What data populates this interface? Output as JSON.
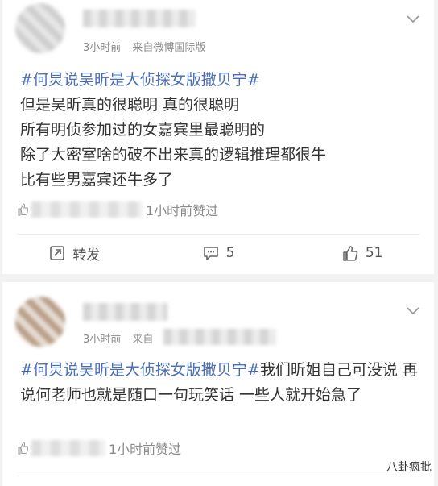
{
  "post1": {
    "meta_time": "3小时前",
    "meta_source": "来自微博国际版",
    "hashtag": "#何炅说吴昕是大侦探女版撒贝宁#",
    "lines": [
      "但是吴昕真的很聪明 真的很聪明",
      "所有明侦参加过的女嘉宾里最聪明的",
      "除了大密室啥的破不出来真的逻辑推理都很牛",
      "比有些男嘉宾还牛多了"
    ],
    "liked_text": "1小时前赞过",
    "repost_label": "转发",
    "comment_count": "5",
    "like_count": "51"
  },
  "post2": {
    "meta_time": "3小时前",
    "meta_source_partial": "来自",
    "hashtag": "#何炅说吴昕是大侦探女版撒贝宁#",
    "text_after_hashtag": "我们昕姐自己可没说 再说何老师也就是随口一句玩笑话 一些人就开始急了",
    "liked_text": "1小时前赞过"
  },
  "watermark": "八卦疯批",
  "icons": {
    "chevron": "chevron-down-icon",
    "like_small": "thumbs-up-icon",
    "repost": "repost-icon",
    "comment": "comment-icon",
    "like": "like-icon"
  }
}
